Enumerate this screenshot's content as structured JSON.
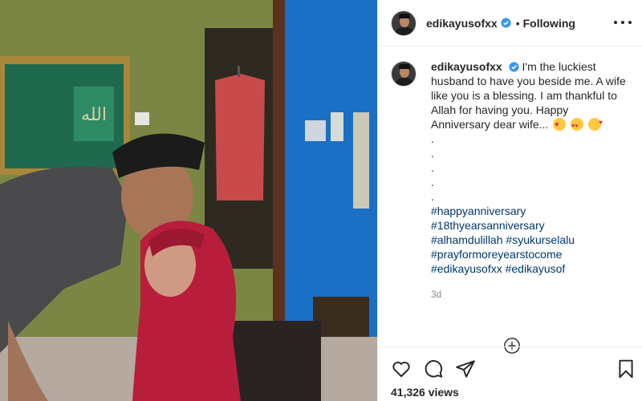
{
  "post": {
    "username": "edikayusofxx",
    "separator": "•",
    "follow_status": "Following",
    "caption": "I'm the luckiest husband to have you beside me. A wife like you is a blessing. I am thankful to Allah for having you. Happy Anniversary dear wife...",
    "dots": [
      ".",
      ".",
      ".",
      ".",
      "."
    ],
    "hashtags": {
      "h1": "#happyanniversary",
      "h2": "#18thyearsanniversary",
      "h3a": "#alhamdulillah",
      "h3b": "#syukurselalu",
      "h4": "#prayformoreyearstocome",
      "h5a": "#edikayusofxx",
      "h5b": "#edikayusof"
    },
    "time_ago": "3d",
    "views": "41,326 views"
  },
  "icons": {
    "more": "more-options-icon",
    "verified": "verified-badge-icon",
    "like": "heart-icon",
    "comment": "comment-icon",
    "share": "paper-plane-icon",
    "save": "bookmark-icon",
    "load_more": "plus-circle-icon"
  },
  "colors": {
    "accent_blue": "#3897f0",
    "hashtag": "#00376b",
    "muted": "#8e8e8e",
    "text": "#262626"
  }
}
